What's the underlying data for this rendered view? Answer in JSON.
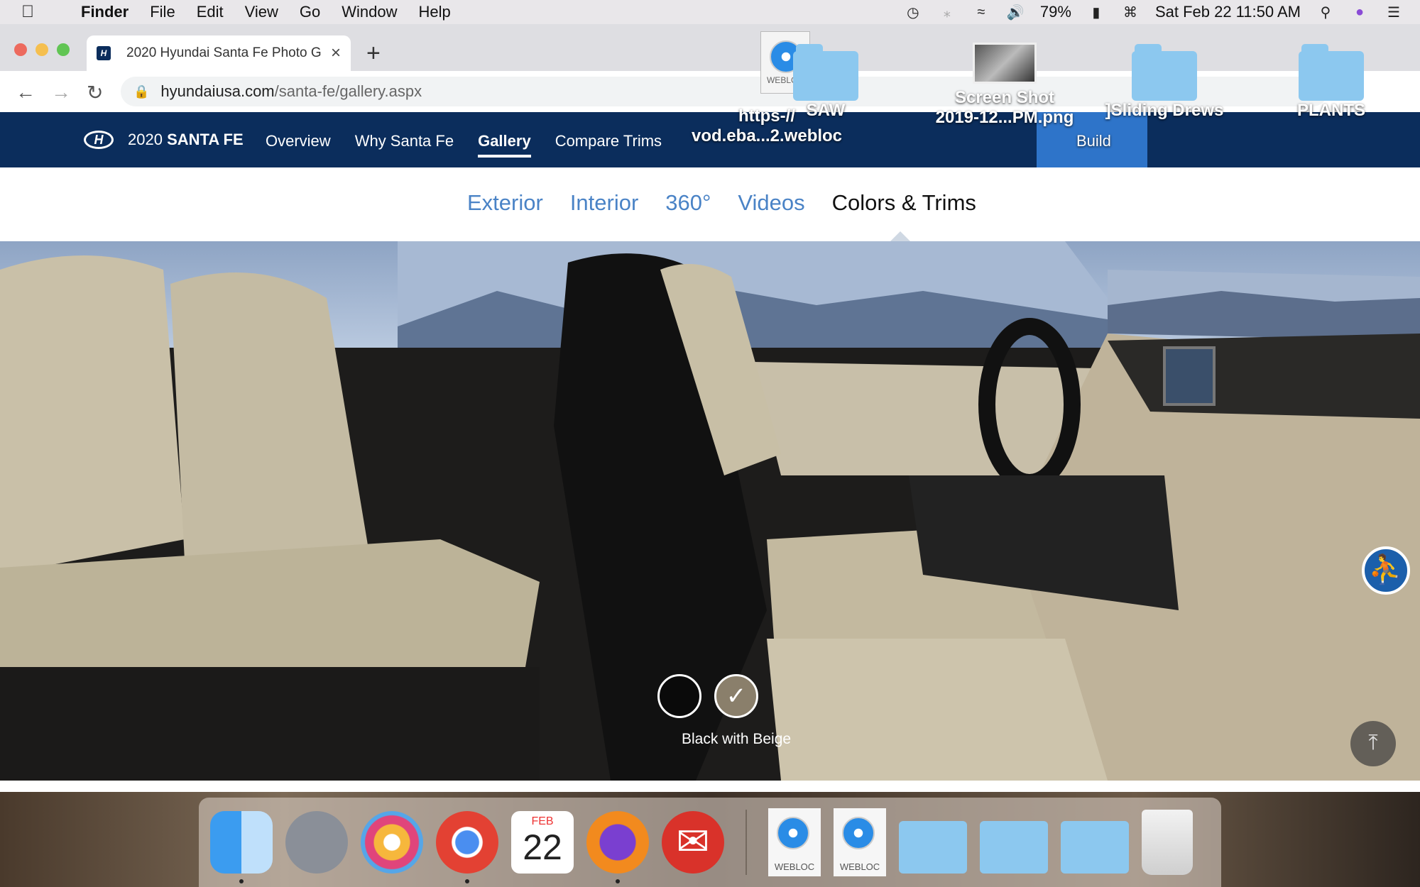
{
  "menubar": {
    "app": "Finder",
    "items": [
      "File",
      "Edit",
      "View",
      "Go",
      "Window",
      "Help"
    ],
    "battery": "79%",
    "datetime": "Sat Feb 22  11:50 AM"
  },
  "browser": {
    "tab_title": "2020 Hyundai Santa Fe Photo G",
    "url_host": "hyundaiusa.com",
    "url_path": "/santa-fe/gallery.aspx"
  },
  "site": {
    "model_year": "2020",
    "model_name": "SANTA FE",
    "nav": [
      "Overview",
      "Why Santa Fe",
      "Gallery",
      "Compare Trims"
    ],
    "active_nav": "Gallery",
    "build_label": "Build",
    "subtabs": [
      "Exterior",
      "Interior",
      "360°",
      "Videos",
      "Colors & Trims"
    ],
    "active_subtab": "Colors & Trims",
    "swatch_label": "Black with Beige",
    "colors": {
      "navy": "#0b2d5c",
      "link_blue": "#4a83c6",
      "build_blue": "#2e74c9"
    }
  },
  "desktop_icons": {
    "webloc_top_label": "WEBLOC",
    "webloc_file": "https-//\nvod.eba...2.webloc",
    "saw": "SAW",
    "screenshot": "Screen Shot\n2019-12...PM.png",
    "sliding": "]Sliding Drews",
    "plants": "PLANTS"
  },
  "dock": {
    "calendar_month": "FEB",
    "calendar_day": "22",
    "webloc_label_1": "WEBLOC",
    "webloc_label_2": "WEBLOC"
  }
}
